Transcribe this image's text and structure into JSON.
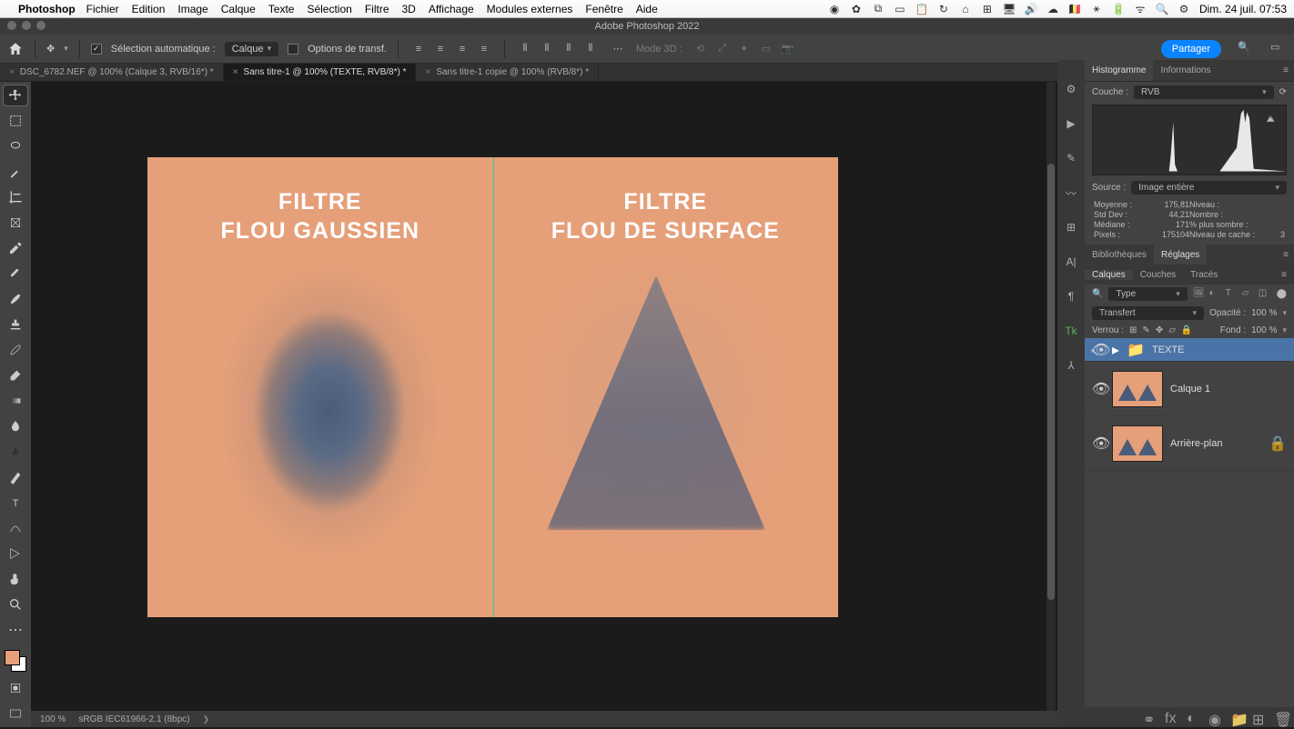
{
  "menubar": {
    "app": "Photoshop",
    "items": [
      "Fichier",
      "Edition",
      "Image",
      "Calque",
      "Texte",
      "Sélection",
      "Filtre",
      "3D",
      "Affichage",
      "Modules externes",
      "Fenêtre",
      "Aide"
    ],
    "clock": "Dim. 24 juil. 07:53"
  },
  "window_title": "Adobe Photoshop 2022",
  "options": {
    "auto_select": "Sélection automatique :",
    "auto_select_value": "Calque",
    "transform": "Options de transf.",
    "mode3d": "Mode 3D :",
    "share": "Partager"
  },
  "tabs": [
    {
      "label": "DSC_6782.NEF @ 100% (Calque 3, RVB/16*) *",
      "active": false
    },
    {
      "label": "Sans titre-1 @ 100% (TEXTE, RVB/8*) *",
      "active": true
    },
    {
      "label": "Sans titre-1 copie @ 100% (RVB/8*) *",
      "active": false
    }
  ],
  "canvas": {
    "left_title_l1": "FILTRE",
    "left_title_l2": "FLOU GAUSSIEN",
    "right_title_l1": "FILTRE",
    "right_title_l2": "FLOU DE SURFACE"
  },
  "histogram_panel": {
    "tab1": "Histogramme",
    "tab2": "Informations",
    "channel_label": "Couche :",
    "channel_value": "RVB",
    "source_label": "Source :",
    "source_value": "Image entière",
    "stats": {
      "moyenne_l": "Moyenne :",
      "moyenne_v": "175,81",
      "stddev_l": "Std Dev :",
      "stddev_v": "44,21",
      "mediane_l": "Médiane :",
      "mediane_v": "171",
      "pixels_l": "Pixels :",
      "pixels_v": "175104",
      "niveau_l": "Niveau :",
      "niveau_v": "",
      "nombre_l": "Nombre :",
      "nombre_v": "",
      "pct_l": "% plus sombre :",
      "pct_v": "",
      "cache_l": "Niveau de cache :",
      "cache_v": "3"
    }
  },
  "mid_panel": {
    "tab1": "Bibliothèques",
    "tab2": "Réglages"
  },
  "layers_panel": {
    "tabs": {
      "t1": "Calques",
      "t2": "Couches",
      "t3": "Tracés"
    },
    "filter_label": "Type",
    "blend_mode": "Transfert",
    "opacity_label": "Opacité :",
    "opacity_value": "100 %",
    "lock_label": "Verrou :",
    "fill_label": "Fond :",
    "fill_value": "100 %",
    "items": [
      {
        "name": "TEXTE",
        "group": true
      },
      {
        "name": "Calque 1",
        "group": false
      },
      {
        "name": "Arrière-plan",
        "group": false,
        "locked": true
      }
    ]
  },
  "status": {
    "zoom": "100 %",
    "profile": "sRGB IEC61966-2.1 (8bpc)"
  }
}
